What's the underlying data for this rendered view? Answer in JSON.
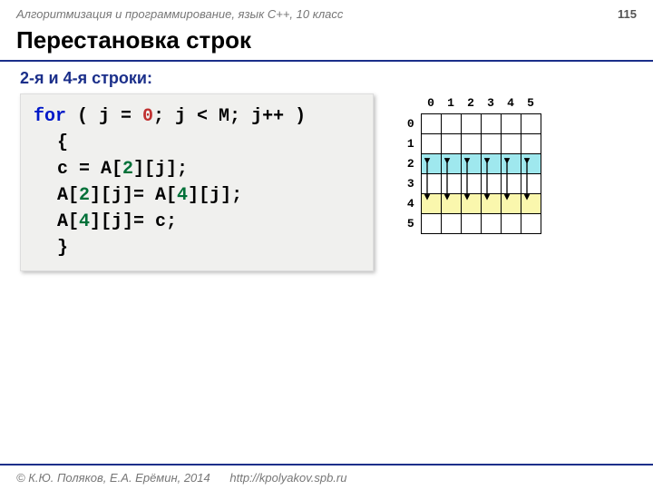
{
  "header": {
    "course": "Алгоритмизация и программирование, язык C++, 10 класс",
    "page": "115"
  },
  "title": "Перестановка строк",
  "subtitle": "2-я и 4-я строки:",
  "code": {
    "l1a": "for",
    "l1b": " ( j = ",
    "l1c": "0",
    "l1d": "; j < M; j++ )",
    "l2": "{",
    "l3a": "c = A[",
    "l3b": "2",
    "l3c": "][j];",
    "l4a": "A[",
    "l4b": "2",
    "l4c": "][j]= A[",
    "l4d": "4",
    "l4e": "][j];",
    "l5a": "A[",
    "l5b": "4",
    "l5c": "][j]= c;",
    "l6": "}"
  },
  "grid": {
    "cols": [
      "0",
      "1",
      "2",
      "3",
      "4",
      "5"
    ],
    "rows": [
      "0",
      "1",
      "2",
      "3",
      "4",
      "5"
    ]
  },
  "footer": {
    "copyright": "© К.Ю. Поляков, Е.А. Ерёмин, 2014",
    "url": "http://kpolyakov.spb.ru"
  }
}
